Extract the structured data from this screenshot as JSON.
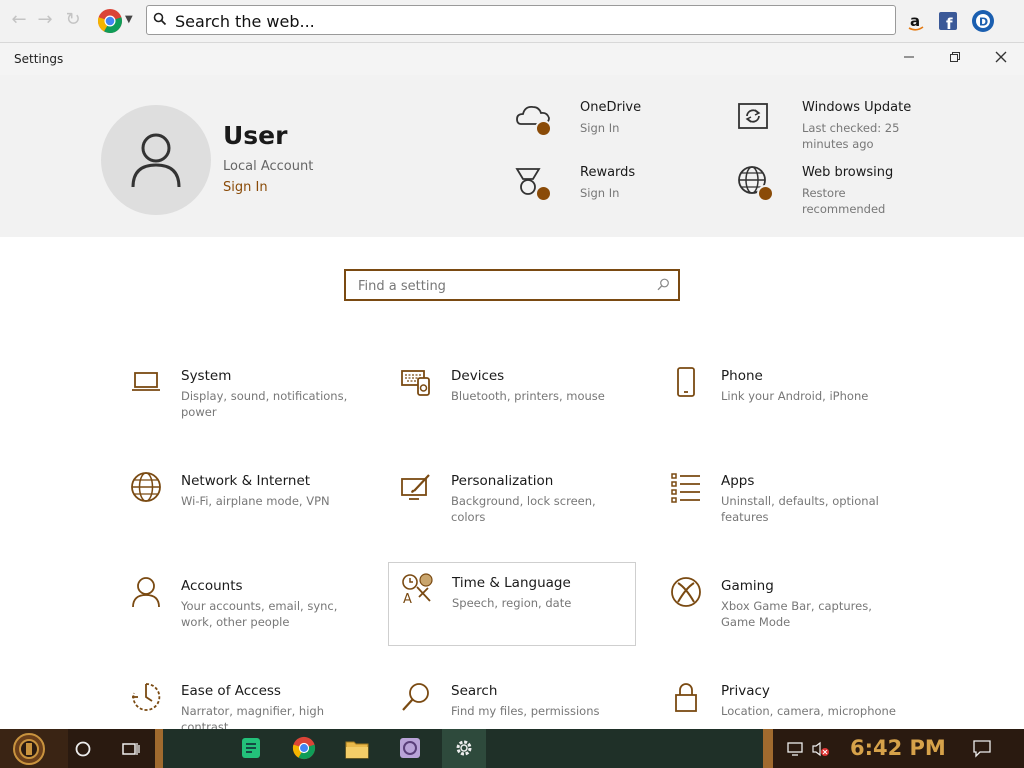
{
  "browser": {
    "address_placeholder": "Search the web...",
    "address_value": ""
  },
  "window": {
    "title": "Settings"
  },
  "account": {
    "name": "User",
    "type": "Local Account",
    "sign_in": "Sign In"
  },
  "services": [
    {
      "name": "OneDrive",
      "sub": "Sign In",
      "icon": "cloud-icon"
    },
    {
      "name": "Windows Update",
      "sub": "Last checked: 25 minutes ago",
      "icon": "update-icon"
    },
    {
      "name": "Rewards",
      "sub": "Sign In",
      "icon": "medal-icon"
    },
    {
      "name": "Web browsing",
      "sub": "Restore recommended",
      "icon": "globe-icon"
    }
  ],
  "search": {
    "placeholder": "Find a setting"
  },
  "categories": [
    {
      "name": "System",
      "desc": "Display, sound, notifications, power",
      "icon": "laptop-icon"
    },
    {
      "name": "Devices",
      "desc": "Bluetooth, printers, mouse",
      "icon": "keyboard-icon"
    },
    {
      "name": "Phone",
      "desc": "Link your Android, iPhone",
      "icon": "phone-icon"
    },
    {
      "name": "Network & Internet",
      "desc": "Wi-Fi, airplane mode, VPN",
      "icon": "globe-icon"
    },
    {
      "name": "Personalization",
      "desc": "Background, lock screen, colors",
      "icon": "paintbrush-icon"
    },
    {
      "name": "Apps",
      "desc": "Uninstall, defaults, optional features",
      "icon": "apps-list-icon"
    },
    {
      "name": "Accounts",
      "desc": "Your accounts, email, sync, work, other people",
      "icon": "person-icon"
    },
    {
      "name": "Time & Language",
      "desc": "Speech, region, date",
      "icon": "time-language-icon"
    },
    {
      "name": "Gaming",
      "desc": "Xbox Game Bar, captures, Game Mode",
      "icon": "xbox-icon"
    },
    {
      "name": "Ease of Access",
      "desc": "Narrator, magnifier, high contrast",
      "icon": "ease-of-access-icon"
    },
    {
      "name": "Search",
      "desc": "Find my files, permissions",
      "icon": "search-icon"
    },
    {
      "name": "Privacy",
      "desc": "Location, camera, microphone",
      "icon": "lock-icon"
    }
  ],
  "taskbar": {
    "clock": "6:42 PM"
  },
  "colors": {
    "accent": "#8a4b08",
    "taskbar": "#2a1a10",
    "clock": "#d6a24a"
  }
}
